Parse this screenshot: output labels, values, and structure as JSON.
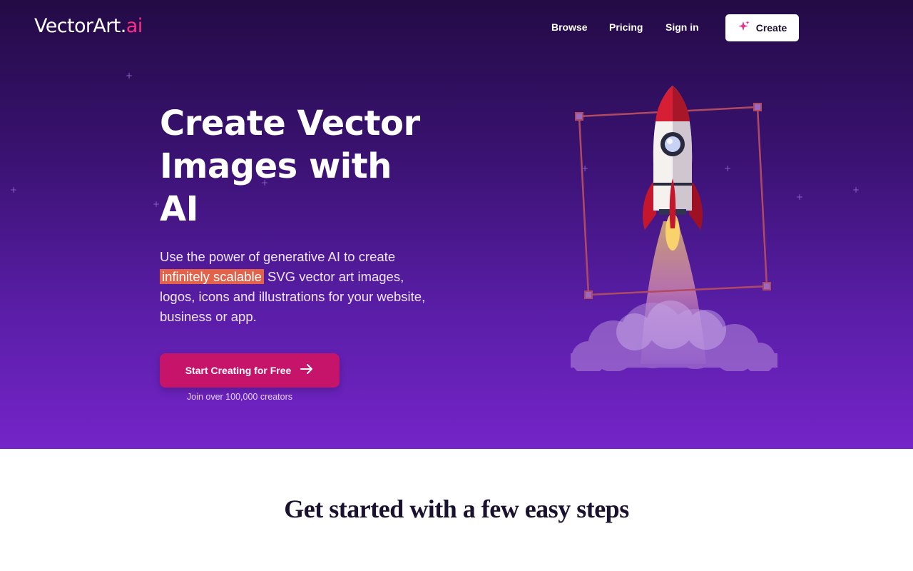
{
  "brand": {
    "name_main": "VectorArt.",
    "name_suffix": "ai"
  },
  "nav": {
    "links": [
      "Browse",
      "Pricing",
      "Sign in"
    ],
    "create_label": "Create"
  },
  "hero": {
    "headline_line1": "Create Vector",
    "headline_line2": "Images with",
    "headline_line3": "AI",
    "sub_before": "Use the power of generative AI to create",
    "sub_highlight": "infinitely scalable",
    "sub_after": "SVG vector art images, logos, icons and illustrations for your website, business or app.",
    "cta_label": "Start Creating for Free",
    "cta_note": "Join over 100,000 creators"
  },
  "steps": {
    "title": "Get started with a few easy steps"
  },
  "colors": {
    "accent": "#ff2d8a",
    "cta": "#c5146a",
    "highlight": "#e2634a",
    "hero_top": "#230b45",
    "hero_bottom": "#7524c8"
  },
  "icons": {
    "create": "sparkle-icon",
    "cta": "arrow-right-icon",
    "hero_art": "rocket-illustration"
  }
}
